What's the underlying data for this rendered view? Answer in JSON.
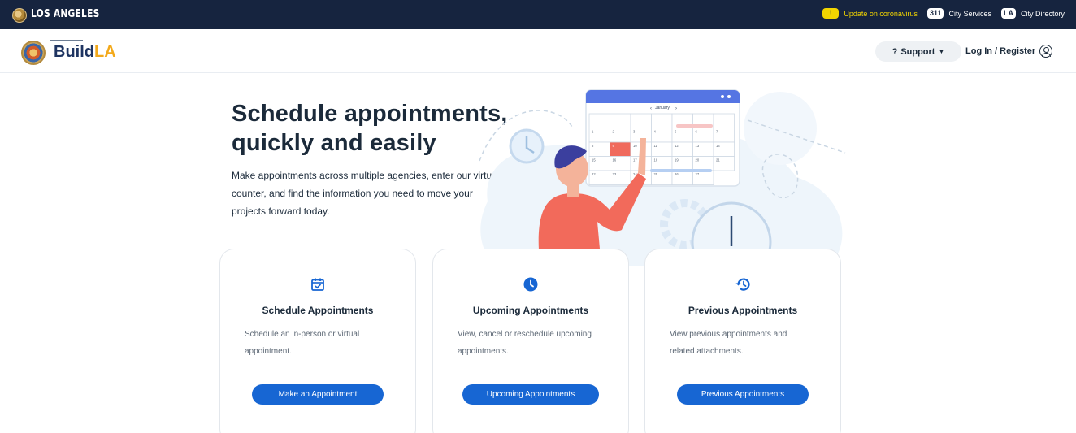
{
  "topbar": {
    "city_name": "LOS ANGELES",
    "alert_badge": "!",
    "alert_text": "Update on coronavirus",
    "services_badge": "311",
    "services_text": "City Services",
    "directory_badge": "LA",
    "directory_text": "City Directory"
  },
  "header": {
    "brand_prefix": "Build",
    "brand_suffix": "LA",
    "support_label": "Support",
    "login_label": "Log In / Register"
  },
  "hero": {
    "title_line1": "Schedule appointments,",
    "title_line2": "quickly and easily",
    "description_line1": "Make appointments across multiple agencies, enter our virtual",
    "description_line2": "counter, and find the information you need to move your",
    "description_line3": "projects forward today.",
    "calendar_month": "January",
    "calendar_days": [
      "",
      "",
      "",
      "",
      "",
      "",
      "",
      "1",
      "2",
      "3",
      "4",
      "5",
      "6",
      "7",
      "8",
      "9",
      "10",
      "11",
      "12",
      "13",
      "14",
      "15",
      "16",
      "17",
      "18",
      "19",
      "20",
      "21",
      "22",
      "23",
      "24",
      "25",
      "26",
      "27"
    ]
  },
  "cards": [
    {
      "icon": "calendar-check-icon",
      "title": "Schedule Appointments",
      "desc_line1": "Schedule an in-person or virtual",
      "desc_line2": "appointment.",
      "button": "Make an Appointment"
    },
    {
      "icon": "clock-icon",
      "title": "Upcoming Appointments",
      "desc_line1": "View, cancel or reschedule upcoming",
      "desc_line2": "appointments.",
      "button": "Upcoming Appointments"
    },
    {
      "icon": "history-icon",
      "title": "Previous Appointments",
      "desc_line1": "View previous appointments and",
      "desc_line2": "related attachments.",
      "button": "Previous Appointments"
    }
  ],
  "colors": {
    "topbar": "#16243f",
    "primary": "#1766d3",
    "brand_accent": "#f3a91a",
    "alert": "#f2d500"
  }
}
